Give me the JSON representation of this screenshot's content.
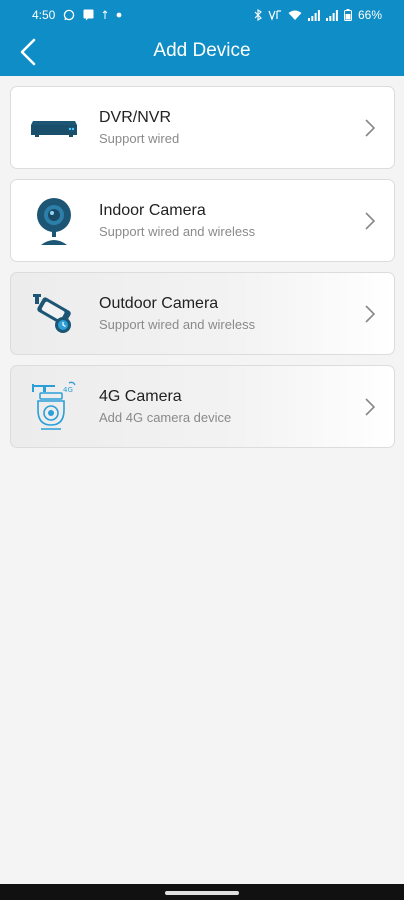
{
  "status_bar": {
    "time": "4:50",
    "battery_percent": "66%",
    "icons_left": [
      "whatsapp-icon",
      "notification-icon",
      "signal-dot-icon",
      "dot-icon"
    ],
    "icons_right": [
      "bluetooth-icon",
      "volte-icon",
      "wifi-icon",
      "signal-icon",
      "signal-icon",
      "battery-icon"
    ]
  },
  "header": {
    "title": "Add Device",
    "back_icon": "back-arrow-icon",
    "color": "#0f8dc6"
  },
  "devices": [
    {
      "title": "DVR/NVR",
      "subtitle": "Support wired",
      "icon": "dvr-icon"
    },
    {
      "title": "Indoor Camera",
      "subtitle": "Support wired and wireless",
      "icon": "indoor-camera-icon"
    },
    {
      "title": "Outdoor Camera",
      "subtitle": "Support wired and wireless",
      "icon": "outdoor-camera-icon"
    },
    {
      "title": "4G Camera",
      "subtitle": "Add 4G camera device",
      "icon": "4g-camera-icon"
    }
  ]
}
